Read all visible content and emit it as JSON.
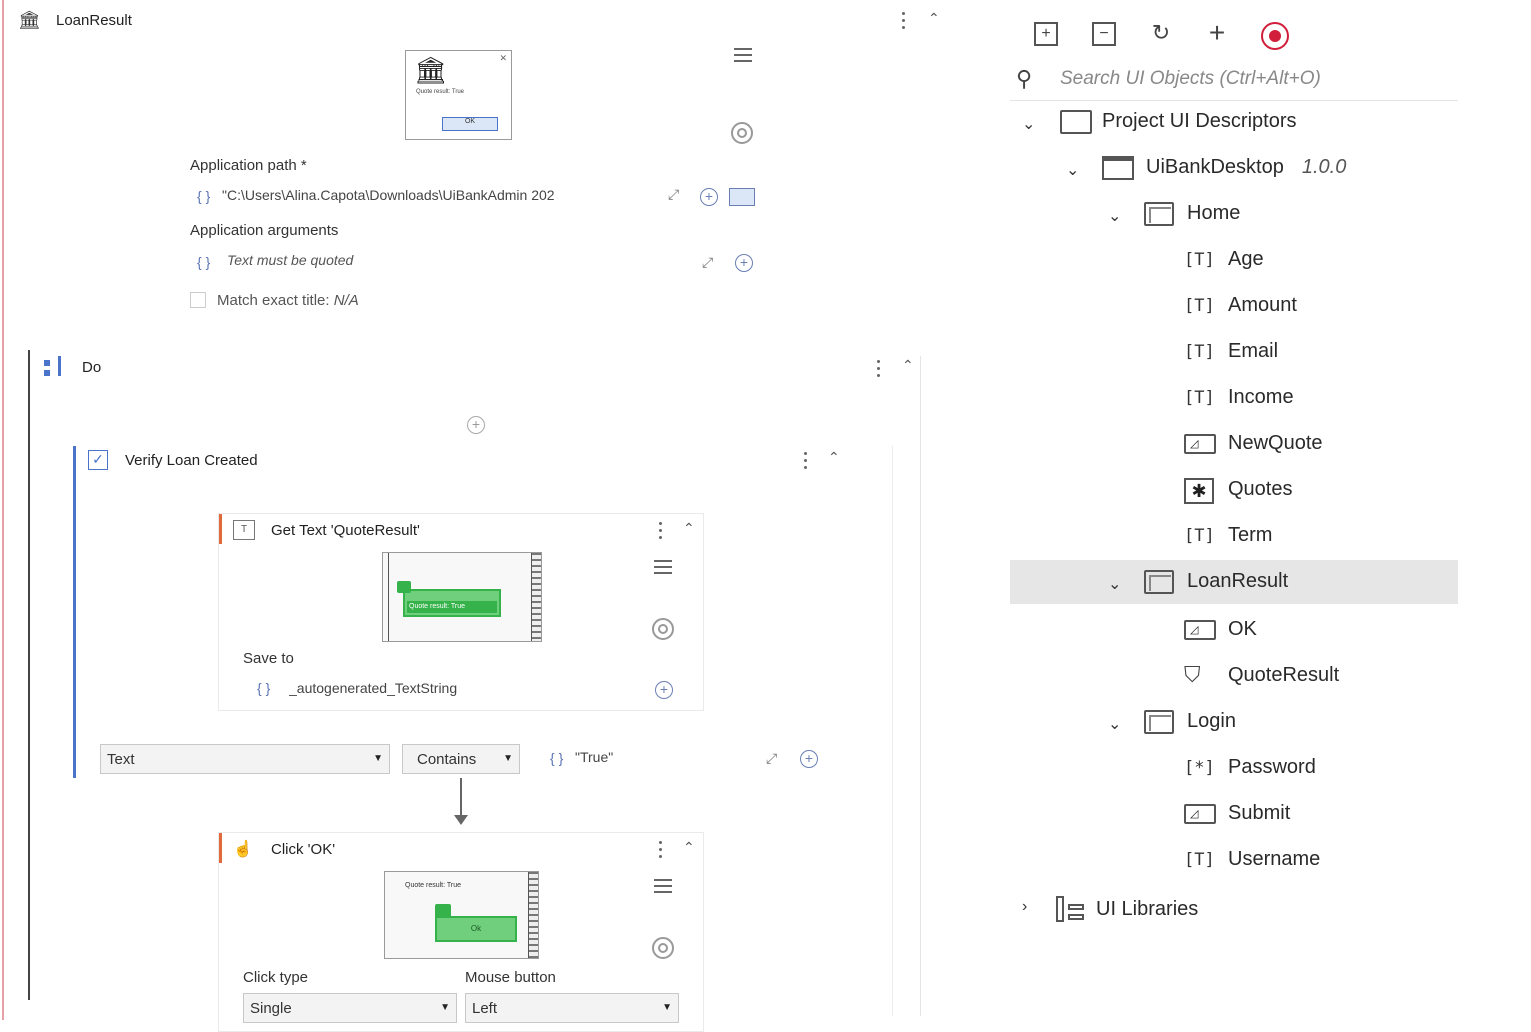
{
  "colors": {
    "accent_blue": "#4a74c9",
    "activity_orange": "#e06a3b",
    "green": "#35b24a",
    "selection": "#e6e6e6"
  },
  "main": {
    "title": "LoanResult",
    "app_path_label": "Application path *",
    "app_path_value": "\"C:\\Users\\Alina.Capota\\Downloads\\UiBankAdmin 202",
    "app_args_label": "Application arguments",
    "app_args_placeholder": "Text must be quoted",
    "match_title_label": "Match exact title:",
    "match_title_value": "N/A",
    "preview_caption": "Quote result: True",
    "preview_button": "OK",
    "do": {
      "label": "Do",
      "verify": {
        "label": "Verify Loan Created",
        "get_text": {
          "label": "Get Text 'QuoteResult'",
          "preview_text": "Quote result: True",
          "save_to_label": "Save to",
          "save_to_value": "_autogenerated_TextString"
        },
        "verify_property": "Text",
        "verify_operator": "Contains",
        "verify_value": "\"True\""
      },
      "click": {
        "label": "Click 'OK'",
        "preview_caption": "Quote result: True",
        "preview_button": "Ok",
        "click_type_label": "Click type",
        "click_type_value": "Single",
        "mouse_button_label": "Mouse button",
        "mouse_button_value": "Left"
      }
    }
  },
  "panel": {
    "toolbar_icons": [
      "expand-all-icon",
      "collapse-all-icon",
      "refresh-icon",
      "add-icon",
      "record-icon"
    ],
    "search_placeholder": "Search UI Objects (Ctrl+Alt+O)",
    "tree": {
      "root": "Project UI Descriptors",
      "app": "UiBankDesktop",
      "app_version": "1.0.0",
      "screens": [
        {
          "name": "Home",
          "elements": [
            "Age",
            "Amount",
            "Email",
            "Income",
            "NewQuote",
            "Quotes",
            "Term"
          ]
        },
        {
          "name": "LoanResult",
          "elements": [
            "OK",
            "QuoteResult"
          ]
        },
        {
          "name": "Login",
          "elements": [
            "Password",
            "Submit",
            "Username"
          ]
        }
      ],
      "libraries": "UI Libraries"
    }
  }
}
